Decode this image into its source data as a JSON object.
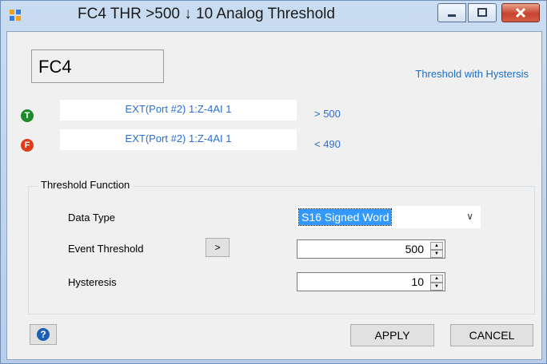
{
  "window": {
    "title": "FC4 THR >500 ↓ 10 Analog Threshold",
    "controls": [
      "minimize",
      "maximize",
      "close"
    ]
  },
  "header": {
    "name": "FC4",
    "mode_link": "Threshold with Hystersis"
  },
  "true_condition": {
    "icon_letter": "T",
    "source": "EXT(Port #2) 1:Z-4AI 1",
    "condition": "> 500",
    "color": "#1f8a2a"
  },
  "false_condition": {
    "icon_letter": "F",
    "source": "EXT(Port #2) 1:Z-4AI 1",
    "condition": "< 490",
    "color": "#e23b1a"
  },
  "threshold_function": {
    "legend": "Threshold Function",
    "data_type": {
      "label": "Data Type",
      "value": "S16 Signed Word"
    },
    "event_threshold": {
      "label": "Event Threshold",
      "operator": ">",
      "value": "500"
    },
    "hysteresis": {
      "label": "Hysteresis",
      "value": "10"
    }
  },
  "footer": {
    "help_icon": "question-icon",
    "apply_label": "APPLY",
    "cancel_label": "CANCEL"
  }
}
